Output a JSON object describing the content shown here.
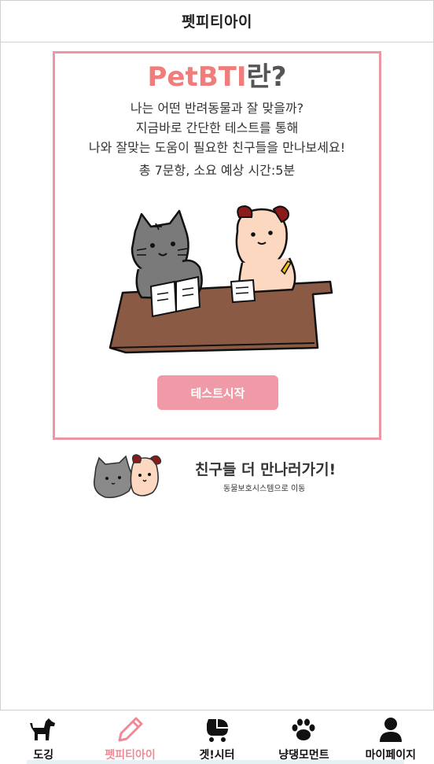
{
  "header": {
    "title": "펫피티아이"
  },
  "card": {
    "title_accent": "PetBTI",
    "title_rest": "란?",
    "desc_lines": [
      "나는 어떤 반려동물과 잘 맞을까?",
      "지금바로 간단한 테스트를 통해",
      "나와 잘맞는 도움이 필요한 친구들을 만나보세요!",
      "총 7문항, 소요 예상 시간:5분"
    ],
    "start_button": "테스트시작"
  },
  "promo": {
    "title": "친구들 더 만나러가기!",
    "subtitle": "동물보호시스템으로 이동"
  },
  "bottom_nav": {
    "items": [
      {
        "label": "도깅",
        "icon": "dog-icon",
        "active": false
      },
      {
        "label": "펫피티아이",
        "icon": "pencil-icon",
        "active": true
      },
      {
        "label": "겟!시터",
        "icon": "stroller-icon",
        "active": false
      },
      {
        "label": "냥댕모먼트",
        "icon": "paw-icon",
        "active": false
      },
      {
        "label": "마이페이지",
        "icon": "user-icon",
        "active": false
      }
    ]
  },
  "colors": {
    "accent": "#ef9aa6",
    "title_accent": "#f07c7c",
    "active_nav": "#ef8a96"
  }
}
